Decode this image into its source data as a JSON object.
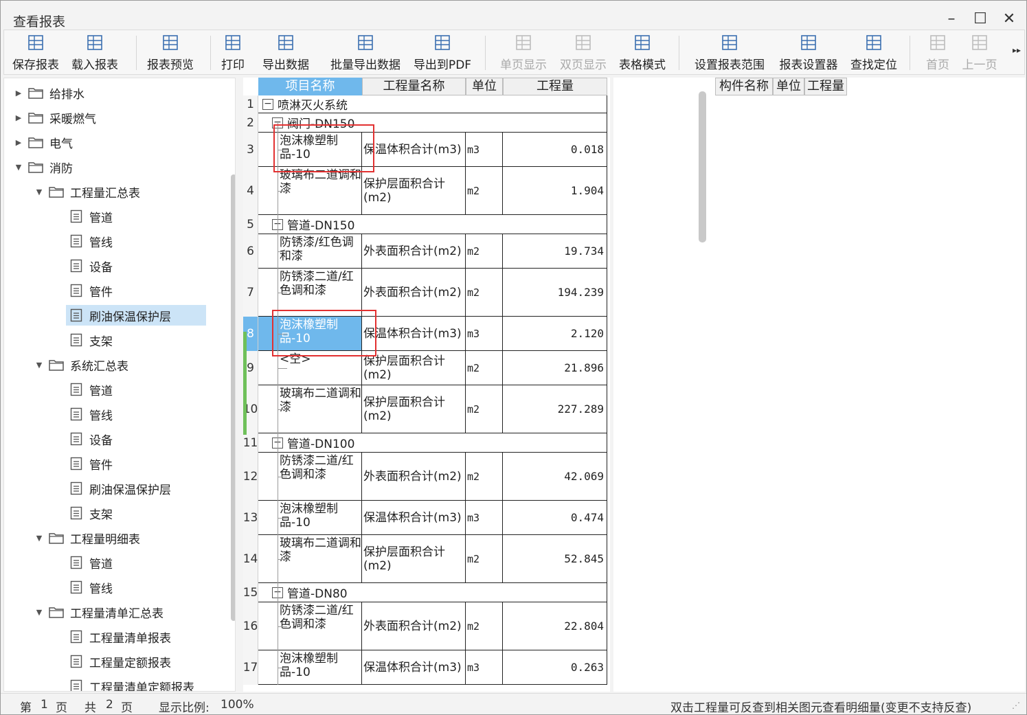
{
  "window": {
    "title": "查看报表"
  },
  "toolbar": {
    "items": [
      {
        "label": "保存报表",
        "icon": "save-report-icon",
        "enabled": true
      },
      {
        "label": "载入报表",
        "icon": "load-report-icon",
        "enabled": true
      },
      {
        "label": "报表预览",
        "icon": "preview-report-icon",
        "enabled": true
      },
      {
        "label": "打印",
        "icon": "print-icon",
        "enabled": true
      },
      {
        "label": "导出数据",
        "icon": "export-data-icon",
        "enabled": true
      },
      {
        "label": "批量导出数据",
        "icon": "batch-export-icon",
        "enabled": true
      },
      {
        "label": "导出到PDF",
        "icon": "export-pdf-icon",
        "enabled": true
      },
      {
        "label": "单页显示",
        "icon": "single-page-icon",
        "enabled": false
      },
      {
        "label": "双页显示",
        "icon": "double-page-icon",
        "enabled": false
      },
      {
        "label": "表格模式",
        "icon": "table-mode-icon",
        "enabled": true
      },
      {
        "label": "设置报表范围",
        "icon": "report-range-icon",
        "enabled": true
      },
      {
        "label": "报表设置器",
        "icon": "report-settings-icon",
        "enabled": true
      },
      {
        "label": "查找定位",
        "icon": "find-locate-icon",
        "enabled": true
      },
      {
        "label": "首页",
        "icon": "first-page-icon",
        "enabled": false
      },
      {
        "label": "上一页",
        "icon": "prev-page-icon",
        "enabled": false
      }
    ],
    "more": "▸▸"
  },
  "tree": {
    "nodes": [
      {
        "label": "给排水",
        "type": "folder",
        "expanded": false
      },
      {
        "label": "采暖燃气",
        "type": "folder",
        "expanded": false
      },
      {
        "label": "电气",
        "type": "folder",
        "expanded": false
      },
      {
        "label": "消防",
        "type": "folder",
        "expanded": true
      },
      {
        "label": "工程量汇总表",
        "type": "folder",
        "expanded": true
      },
      {
        "label": "管道",
        "type": "doc"
      },
      {
        "label": "管线",
        "type": "doc"
      },
      {
        "label": "设备",
        "type": "doc"
      },
      {
        "label": "管件",
        "type": "doc"
      },
      {
        "label": "刷油保温保护层",
        "type": "doc",
        "selected": true
      },
      {
        "label": "支架",
        "type": "doc"
      },
      {
        "label": "系统汇总表",
        "type": "folder",
        "expanded": true
      },
      {
        "label": "管道",
        "type": "doc"
      },
      {
        "label": "管线",
        "type": "doc"
      },
      {
        "label": "设备",
        "type": "doc"
      },
      {
        "label": "管件",
        "type": "doc"
      },
      {
        "label": "刷油保温保护层",
        "type": "doc"
      },
      {
        "label": "支架",
        "type": "doc"
      },
      {
        "label": "工程量明细表",
        "type": "folder",
        "expanded": true
      },
      {
        "label": "管道",
        "type": "doc"
      },
      {
        "label": "管线",
        "type": "doc"
      },
      {
        "label": "工程量清单汇总表",
        "type": "folder",
        "expanded": true
      },
      {
        "label": "工程量清单报表",
        "type": "doc"
      },
      {
        "label": "工程量定额报表",
        "type": "doc"
      },
      {
        "label": "工程量清单定额报表",
        "type": "doc"
      }
    ]
  },
  "report": {
    "columns": [
      "项目名称",
      "工程量名称",
      "单位",
      "工程量"
    ],
    "rows": [
      {
        "n": "1",
        "group": "喷淋灭火系统"
      },
      {
        "n": "2",
        "group": "阀门-DN150"
      },
      {
        "n": "3",
        "name": "泡沫橡塑制品-10",
        "qname": "保温体积合计(m3)",
        "unit": "m3",
        "qty": "0.018"
      },
      {
        "n": "4",
        "name": "玻璃布二道调和漆",
        "qname": "保护层面积合计(m2)",
        "unit": "m2",
        "qty": "1.904"
      },
      {
        "n": "5",
        "group": "管道-DN150"
      },
      {
        "n": "6",
        "name": "防锈漆/红色调和漆",
        "qname": "外表面积合计(m2)",
        "unit": "m2",
        "qty": "19.734"
      },
      {
        "n": "7",
        "name": "防锈漆二道/红色调和漆",
        "qname": "外表面积合计(m2)",
        "unit": "m2",
        "qty": "194.239"
      },
      {
        "n": "8",
        "name": "泡沫橡塑制品-10",
        "qname": "保温体积合计(m3)",
        "unit": "m3",
        "qty": "2.120",
        "selected": true
      },
      {
        "n": "9",
        "name": "<空>",
        "qname": "保护层面积合计(m2)",
        "unit": "m2",
        "qty": "21.896"
      },
      {
        "n": "10",
        "name": "玻璃布二道调和漆",
        "qname": "保护层面积合计(m2)",
        "unit": "m2",
        "qty": "227.289"
      },
      {
        "n": "11",
        "group": "管道-DN100"
      },
      {
        "n": "12",
        "name": "防锈漆二道/红色调和漆",
        "qname": "外表面积合计(m2)",
        "unit": "m2",
        "qty": "42.069"
      },
      {
        "n": "13",
        "name": "泡沫橡塑制品-10",
        "qname": "保温体积合计(m3)",
        "unit": "m3",
        "qty": "0.474"
      },
      {
        "n": "14",
        "name": "玻璃布二道调和漆",
        "qname": "保护层面积合计(m2)",
        "unit": "m2",
        "qty": "52.845"
      },
      {
        "n": "15",
        "group": "管道-DN80"
      },
      {
        "n": "16",
        "name": "防锈漆二道/红色调和漆",
        "qname": "外表面积合计(m2)",
        "unit": "m2",
        "qty": "22.804"
      },
      {
        "n": "17",
        "name": "泡沫橡塑制品-10",
        "qname": "保温体积合计(m3)",
        "unit": "m3",
        "qty": "0.263"
      }
    ]
  },
  "detail": {
    "columns": [
      "构件名称",
      "单位",
      "工程量"
    ]
  },
  "status": {
    "page_prefix": "第",
    "page_current": "1",
    "page_suffix": "页",
    "total_prefix": "共",
    "total_pages": "2",
    "total_suffix": "页",
    "zoom_label": "显示比例:",
    "zoom_value": "100%",
    "hint": "双击工程量可反查到相关图元查看明细量(变更不支持反查)"
  },
  "colors": {
    "selection": "#6fb8ec",
    "tree_selection": "#cce4f7",
    "highlight_box": "#e23030"
  }
}
